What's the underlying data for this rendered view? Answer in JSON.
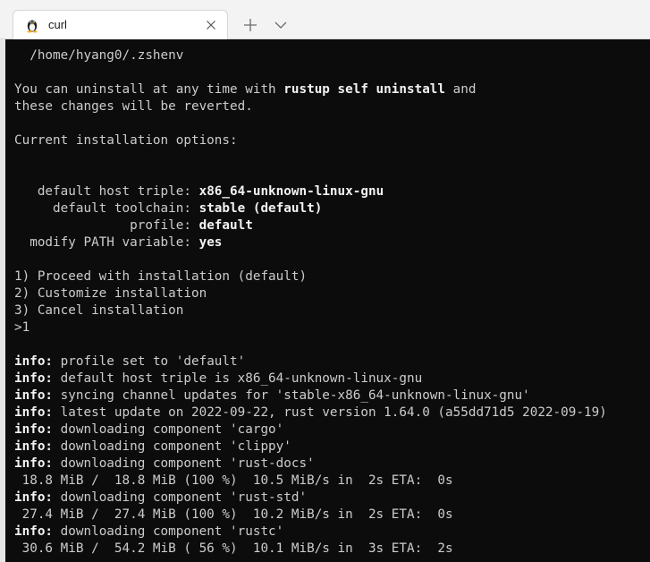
{
  "window": {
    "tab_title": "curl",
    "tab_icon": "linux-penguin-icon",
    "new_tab_icon": "plus-icon",
    "dropdown_icon": "chevron-down-icon",
    "close_icon": "close-icon"
  },
  "colors": {
    "terminal_bg": "#0c0c0c",
    "terminal_fg": "#cccccc",
    "bold_fg": "#f2f2f2",
    "titlebar_bg": "#f3f3f3"
  },
  "terminal": {
    "lines": [
      [
        {
          "t": "  /home/hyang0/.zshenv"
        }
      ],
      [],
      [
        {
          "t": "You can uninstall at any time with "
        },
        {
          "t": "rustup self uninstall",
          "b": true
        },
        {
          "t": " and"
        }
      ],
      [
        {
          "t": "these changes will be reverted."
        }
      ],
      [],
      [
        {
          "t": "Current installation options:"
        }
      ],
      [],
      [],
      [
        {
          "t": "   default host triple: "
        },
        {
          "t": "x86_64-unknown-linux-gnu",
          "b": true
        }
      ],
      [
        {
          "t": "     default toolchain: "
        },
        {
          "t": "stable (default)",
          "b": true
        }
      ],
      [
        {
          "t": "               profile: "
        },
        {
          "t": "default",
          "b": true
        }
      ],
      [
        {
          "t": "  modify PATH variable: "
        },
        {
          "t": "yes",
          "b": true
        }
      ],
      [],
      [
        {
          "t": "1) Proceed with installation (default)"
        }
      ],
      [
        {
          "t": "2) Customize installation"
        }
      ],
      [
        {
          "t": "3) Cancel installation"
        }
      ],
      [
        {
          "t": ">1"
        }
      ],
      [],
      [
        {
          "t": "info:",
          "b": true
        },
        {
          "t": " profile set to 'default'"
        }
      ],
      [
        {
          "t": "info:",
          "b": true
        },
        {
          "t": " default host triple is x86_64-unknown-linux-gnu"
        }
      ],
      [
        {
          "t": "info:",
          "b": true
        },
        {
          "t": " syncing channel updates for 'stable-x86_64-unknown-linux-gnu'"
        }
      ],
      [
        {
          "t": "info:",
          "b": true
        },
        {
          "t": " latest update on 2022-09-22, rust version 1.64.0 (a55dd71d5 2022-09-19)"
        }
      ],
      [
        {
          "t": "info:",
          "b": true
        },
        {
          "t": " downloading component 'cargo'"
        }
      ],
      [
        {
          "t": "info:",
          "b": true
        },
        {
          "t": " downloading component 'clippy'"
        }
      ],
      [
        {
          "t": "info:",
          "b": true
        },
        {
          "t": " downloading component 'rust-docs'"
        }
      ],
      [
        {
          "t": " 18.8 MiB /  18.8 MiB (100 %)  10.5 MiB/s in  2s ETA:  0s"
        }
      ],
      [
        {
          "t": "info:",
          "b": true
        },
        {
          "t": " downloading component 'rust-std'"
        }
      ],
      [
        {
          "t": " 27.4 MiB /  27.4 MiB (100 %)  10.2 MiB/s in  2s ETA:  0s"
        }
      ],
      [
        {
          "t": "info:",
          "b": true
        },
        {
          "t": " downloading component 'rustc'"
        }
      ],
      [
        {
          "t": " 30.6 MiB /  54.2 MiB ( 56 %)  10.1 MiB/s in  3s ETA:  2s"
        }
      ]
    ]
  }
}
